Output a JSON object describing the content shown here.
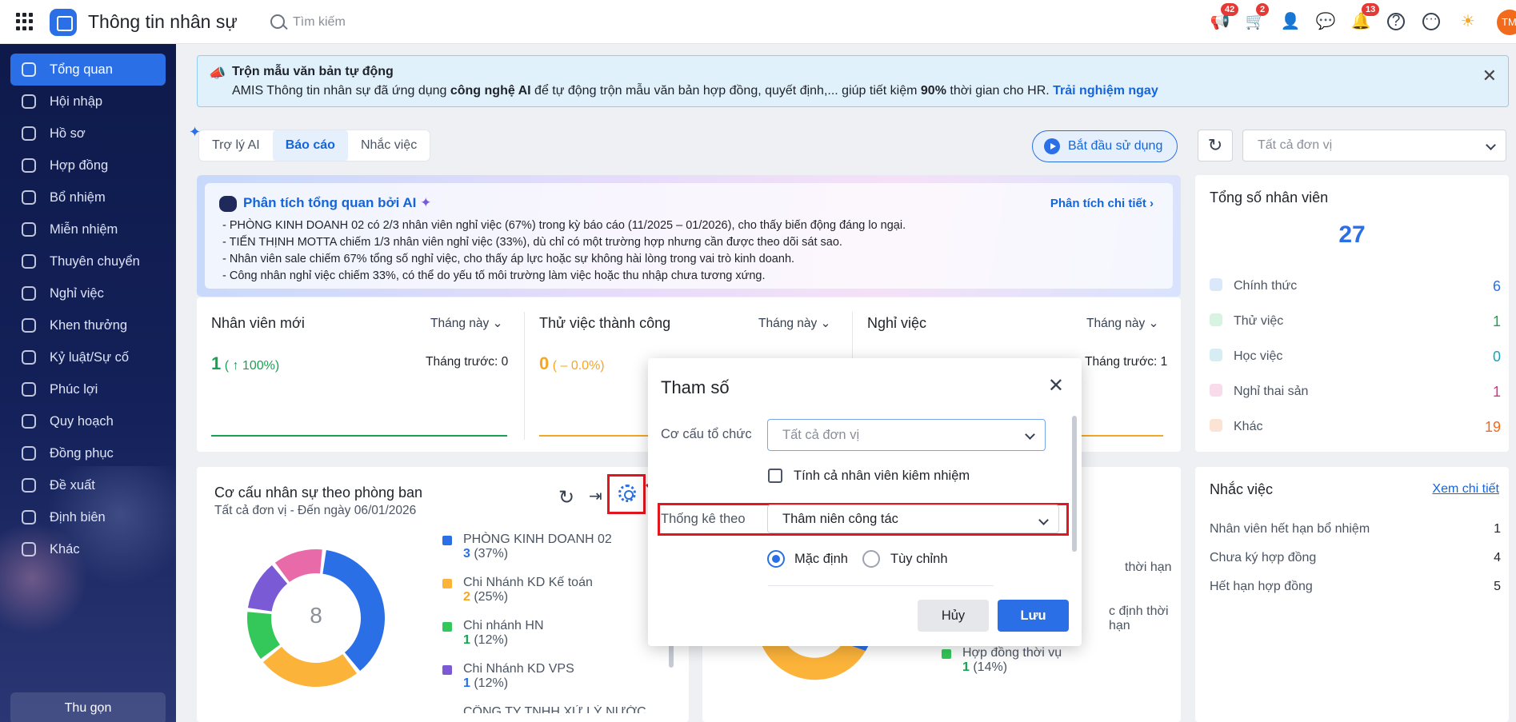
{
  "app": {
    "title": "Thông tin nhân sự",
    "search_placeholder": "Tìm kiếm"
  },
  "top_icons": [
    {
      "name": "megaphone-icon",
      "badge": "42"
    },
    {
      "name": "cart-icon",
      "badge": "2"
    },
    {
      "name": "add-user-icon",
      "badge": ""
    },
    {
      "name": "chat-icon",
      "badge": ""
    },
    {
      "name": "bell-icon",
      "badge": "13"
    },
    {
      "name": "help-icon",
      "badge": ""
    },
    {
      "name": "more-icon",
      "badge": ""
    },
    {
      "name": "sun-icon",
      "badge": ""
    }
  ],
  "avatar": "TM",
  "sidebar": {
    "items": [
      "Tổng quan",
      "Hội nhập",
      "Hồ sơ",
      "Hợp đồng",
      "Bổ nhiệm",
      "Miễn nhiệm",
      "Thuyên chuyển",
      "Nghỉ việc",
      "Khen thưởng",
      "Kỷ luật/Sự cố",
      "Phúc lợi",
      "Quy hoạch",
      "Đồng phục",
      "Đề xuất",
      "Định biên",
      "Khác"
    ],
    "collapse": "Thu gọn"
  },
  "banner": {
    "title": "Trộn mẫu văn bản tự động",
    "text_1": "AMIS Thông tin nhân sự đã ứng dụng ",
    "text_bold_1": "công nghệ AI",
    "text_2": " để tự động trộn mẫu văn bản hợp đồng, quyết định,... giúp tiết kiệm ",
    "text_bold_2": "90%",
    "text_3": " thời gian cho HR. ",
    "link": "Trải nghiệm ngay"
  },
  "tabs": [
    "Trợ lý AI",
    "Báo cáo",
    "Nhắc việc"
  ],
  "start_button": "Bắt đầu sử dụng",
  "unit_select": "Tất cả đơn vị",
  "ai": {
    "title": "Phân tích tổng quan bởi AI",
    "link": "Phân tích chi tiết",
    "lines": [
      "- PHÒNG KINH DOANH 02 có 2/3 nhân viên nghỉ việc (67%) trong kỳ báo cáo (11/2025 – 01/2026), cho thấy biến động đáng lo ngại.",
      "- TIẾN THỊNH MOTTA chiếm 1/3 nhân viên nghỉ việc (33%), dù chỉ có một trường hợp nhưng cần được theo dõi sát sao.",
      "- Nhân viên sale chiếm 67% tổng số nghỉ việc, cho thấy áp lực hoặc sự không hài lòng trong vai trò kinh doanh.",
      "- Công nhân nghỉ việc chiếm 33%, có thể do yếu tố môi trường làm việc hoặc thu nhập chưa tương xứng."
    ]
  },
  "kpis": [
    {
      "title": "Nhân viên mới",
      "period": "Tháng này",
      "value": "1",
      "change": "( ↑ 100%)",
      "prev": "Tháng trước: 0",
      "color": "#1aa252"
    },
    {
      "title": "Thử việc thành công",
      "period": "Tháng này",
      "value": "0",
      "change": "( – 0.0%)",
      "prev": "",
      "color": "#f5a623"
    },
    {
      "title": "Nghỉ việc",
      "period": "Tháng này",
      "value": "",
      "change": "",
      "prev": "Tháng trước: 1",
      "color": "#f5a623"
    }
  ],
  "total": {
    "title": "Tổng số nhân viên",
    "value": "27",
    "rows": [
      {
        "label": "Chính thức",
        "value": "6",
        "color": "#2b6fe6"
      },
      {
        "label": "Thử việc",
        "value": "1",
        "color": "#1aa252"
      },
      {
        "label": "Học việc",
        "value": "0",
        "color": "#17a2b8"
      },
      {
        "label": "Nghỉ thai sản",
        "value": "1",
        "color": "#d63384"
      },
      {
        "label": "Khác",
        "value": "19",
        "color": "#f26a1b"
      }
    ]
  },
  "structure": {
    "title": "Cơ cấu nhân sự theo phòng ban",
    "subtitle": "Tất cả đơn vị - Đến ngày 06/01/2026",
    "center": "8",
    "legend": [
      {
        "name": "PHÒNG KINH DOANH 02",
        "count": "3",
        "pct": " (37%)",
        "color": "#2b6fe6"
      },
      {
        "name": "Chi Nhánh KD Kế toán",
        "count": "2",
        "pct": " (25%)",
        "color": "#fbb33a"
      },
      {
        "name": "Chi nhánh HN",
        "count": "1",
        "pct": " (12%)",
        "color": "#34c759"
      },
      {
        "name": "Chi Nhánh KD VPS",
        "count": "1",
        "pct": " (12%)",
        "color": "#7b5ad6"
      },
      {
        "name": "CÔNG TY TNHH XỬ LÝ NƯỚC",
        "count": "",
        "pct": "",
        "color": "#e86aa8"
      }
    ]
  },
  "contract_panel": {
    "items": [
      {
        "name": "thời hạn",
        "count": "",
        "pct": ""
      },
      {
        "name": "c định thời hạn",
        "count": "",
        "pct": ""
      },
      {
        "name": "Hợp đồng thời vụ",
        "count": "1",
        "pct": " (14%)"
      }
    ]
  },
  "reminders": {
    "title": "Nhắc việc",
    "link": "Xem chi tiết",
    "rows": [
      {
        "label": "Nhân viên hết hạn bổ nhiệm",
        "value": "1"
      },
      {
        "label": "Chưa ký hợp đồng",
        "value": "4"
      },
      {
        "label": "Hết hạn hợp đồng",
        "value": "5"
      }
    ]
  },
  "modal": {
    "title": "Tham số",
    "org_label": "Cơ cấu tổ chức",
    "org_placeholder": "Tất cả đơn vị",
    "concurrent_label": "Tính cả nhân viên kiêm nhiệm",
    "stat_label": "Thống kê theo",
    "stat_value": "Thâm niên công tác",
    "radio_default": "Mặc định",
    "radio_custom": "Tùy chỉnh",
    "cancel": "Hủy",
    "save": "Lưu"
  },
  "colors": {
    "accent": "#2b6fe6",
    "highlight": "#e1161e",
    "sidebar": "#14215a"
  }
}
